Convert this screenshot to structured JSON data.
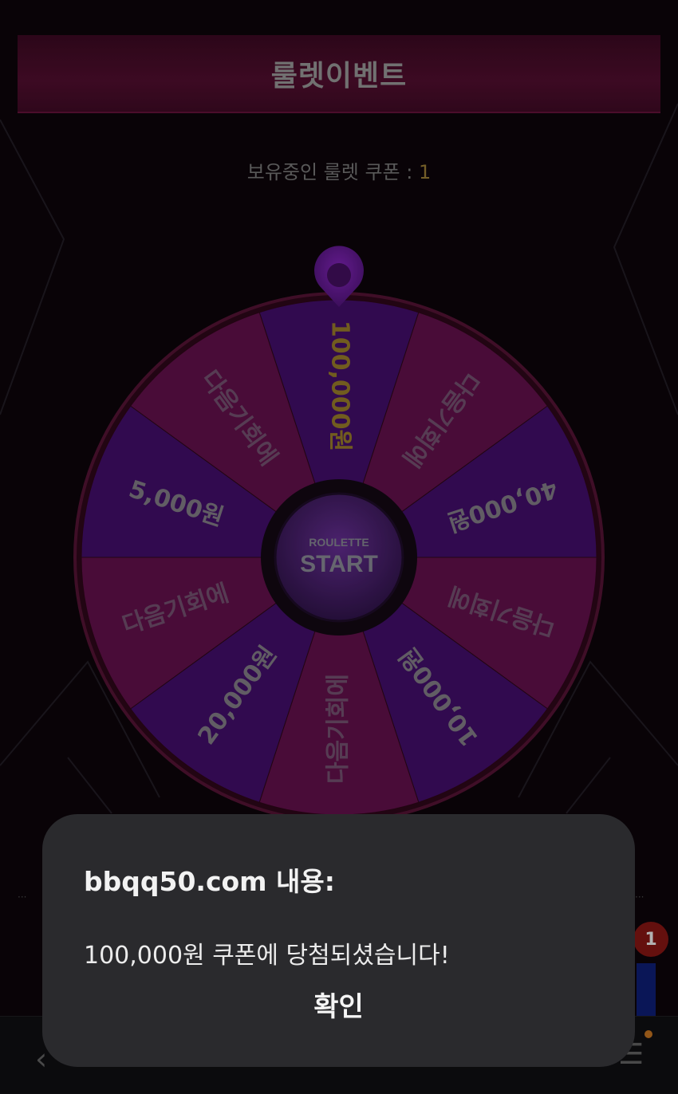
{
  "header": {
    "title": "룰렛이벤트"
  },
  "coupon": {
    "label": "보유중인 룰렛 쿠폰 : ",
    "count": "1"
  },
  "roulette": {
    "segments": [
      "100,000원",
      "다음기회에",
      "40,000원",
      "다음기회에",
      "10,000원",
      "다음기회에",
      "20,000원",
      "다음기회에",
      "5,000원",
      "다음기회에"
    ],
    "center_small": "ROULETTE",
    "center_big": "START"
  },
  "side": {
    "badge": "1"
  },
  "dialog": {
    "title": "bbqq50.com 내용:",
    "message": "100,000원 쿠폰에 당첨되셨습니다!",
    "ok_label": "확인"
  },
  "colors": {
    "background": "#0b0409",
    "title_bar": "#4a0d2b",
    "wheel_magenta": "#5a0f45",
    "wheel_purple": "#3c0d61",
    "pointer": "#5b1587",
    "dialog_bg": "#2a2a2d"
  },
  "icons": {
    "back": "chevron-left-icon",
    "menu": "hamburger-menu-icon",
    "pointer": "map-pin-icon"
  }
}
